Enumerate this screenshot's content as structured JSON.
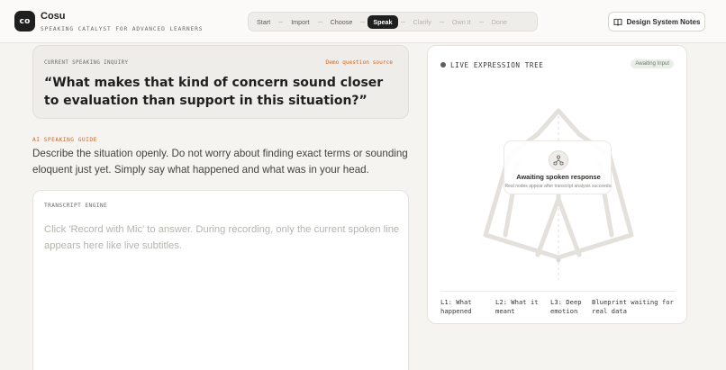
{
  "brand": {
    "logo_text": "co",
    "name": "Cosu",
    "tagline": "SPEAKING CATALYST FOR ADVANCED LEARNERS"
  },
  "steps": [
    {
      "label": "Start",
      "state": "done"
    },
    {
      "label": "Import",
      "state": "done"
    },
    {
      "label": "Choose",
      "state": "done"
    },
    {
      "label": "Speak",
      "state": "active"
    },
    {
      "label": "Clarify",
      "state": "disabled"
    },
    {
      "label": "Own It",
      "state": "disabled"
    },
    {
      "label": "Done",
      "state": "disabled"
    }
  ],
  "header": {
    "notes_button": "Design System Notes",
    "notes_icon": "book-open-icon"
  },
  "inquiry": {
    "label": "CURRENT SPEAKING INQUIRY",
    "source": "Demo question source",
    "question": "“What makes that kind of concern sound closer to evaluation than support in this situation?”"
  },
  "guide": {
    "label": "AI SPEAKING GUIDE",
    "text": "Describe the situation openly. Do not worry about finding exact terms or sounding eloquent just yet. Simply say what happened and what was in your head."
  },
  "transcript": {
    "label": "TRANSCRIPT ENGINE",
    "placeholder": "Click 'Record with Mic' to answer. During recording, only the current spoken line appears here like live subtitles."
  },
  "tree": {
    "title": "LIVE EXPRESSION TREE",
    "badge": "Awaiting Input",
    "await_icon": "network-icon",
    "await_title": "Awaiting spoken response",
    "await_sub": "Real nodes appear after transcript analysis succeeds.",
    "levels": [
      "L1: What happened",
      "L2: What it meant",
      "L3: Deep emotion",
      "Blueprint waiting for real data"
    ]
  },
  "colors": {
    "accent": "#c9692f",
    "dark": "#1f1f1f",
    "background": "#f5f4f1"
  }
}
